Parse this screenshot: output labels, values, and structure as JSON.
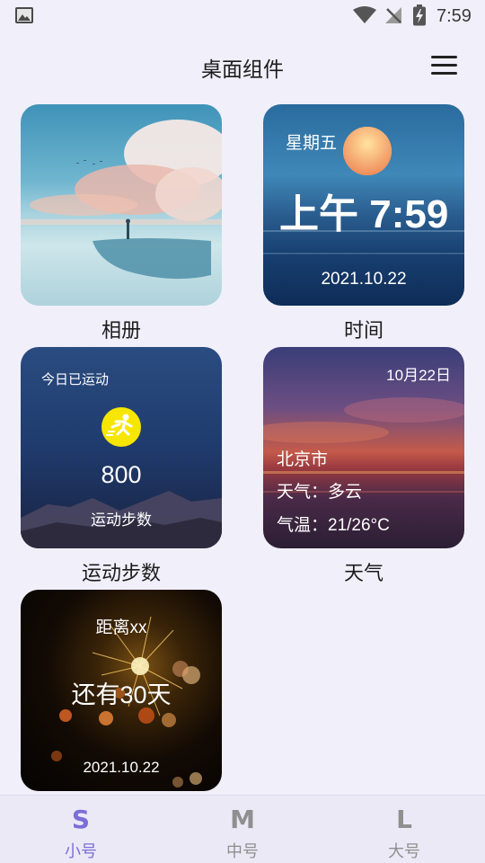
{
  "status_bar": {
    "time": "7:59",
    "icons": [
      "gallery-icon",
      "wifi-icon",
      "signal-off-icon",
      "battery-charging-icon"
    ]
  },
  "header": {
    "title": "桌面组件",
    "menu_icon": "hamburger-menu-icon"
  },
  "widgets": {
    "album": {
      "label": "相册"
    },
    "time": {
      "weekday": "星期五",
      "clock": "上午 7:59",
      "date": "2021.10.22",
      "label": "时间"
    },
    "sport": {
      "heading": "今日已运动",
      "steps": "800",
      "caption": "运动步数",
      "label": "运动步数",
      "icon": "running-person-icon"
    },
    "weather": {
      "date": "10月22日",
      "city": "北京市",
      "condition": "天气：多云",
      "temperature": "气温：21/26°C",
      "label": "天气"
    },
    "countdown": {
      "target": "距离xx",
      "remaining": "还有30天",
      "date": "2021.10.22"
    }
  },
  "bottom_nav": {
    "items": [
      {
        "icon": "S",
        "label": "小号",
        "active": true
      },
      {
        "icon": "M",
        "label": "中号",
        "active": false
      },
      {
        "icon": "L",
        "label": "大号",
        "active": false
      }
    ],
    "active_color": "#7a6fd6",
    "inactive_color": "#8f8f8f"
  }
}
